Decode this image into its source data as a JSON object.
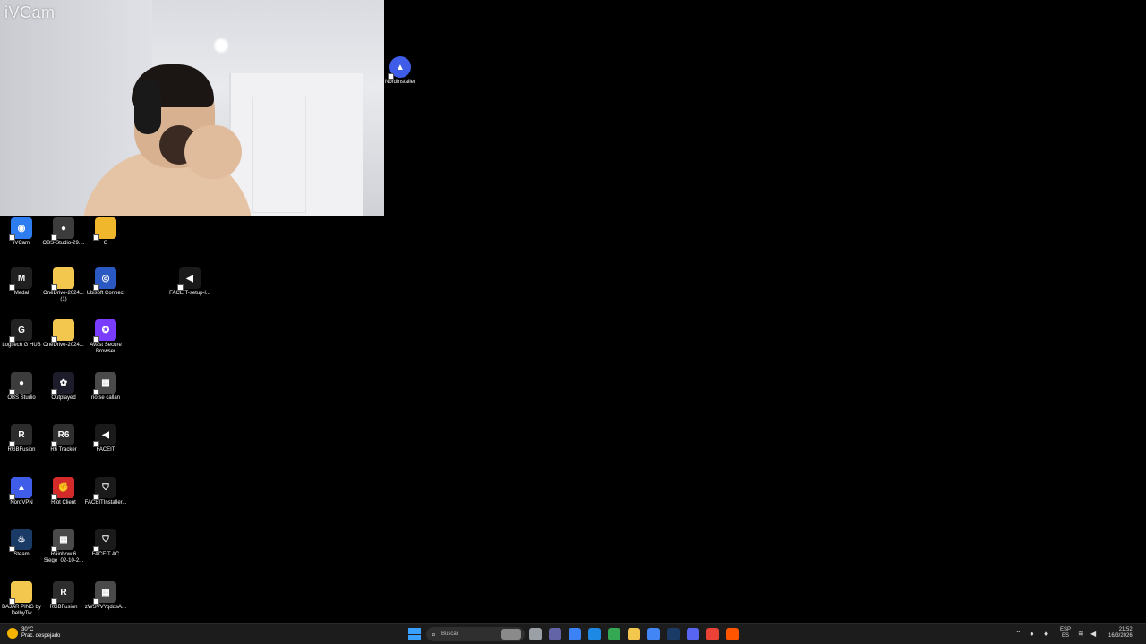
{
  "webcam": {
    "label": "iVCam"
  },
  "desktop": {
    "icons": [
      {
        "label": "iVCam",
        "color": "#2d7cf0",
        "glyph": "◉"
      },
      {
        "label": "OBS-Studio-29....",
        "color": "#3c3c3c",
        "glyph": "●"
      },
      {
        "label": "G",
        "color": "#f0b72c",
        "glyph": ""
      },
      {
        "label": "Medal",
        "color": "#202020",
        "glyph": "M"
      },
      {
        "label": "OneDrive-2024... (1)",
        "color": "#f3c74d",
        "glyph": ""
      },
      {
        "label": "Ubisoft Connect",
        "color": "#2b59c3",
        "glyph": "◎"
      },
      {
        "label": "FACEIT-setup-l...",
        "color": "#1a1a1a",
        "glyph": "◀"
      },
      {
        "label": "Logitech G HUB",
        "color": "#222222",
        "glyph": "G"
      },
      {
        "label": "OneDrive-2024...",
        "color": "#f3c74d",
        "glyph": ""
      },
      {
        "label": "Avast Secure Browser",
        "color": "#7a3cff",
        "glyph": "✪"
      },
      {
        "label": "OBS Studio",
        "color": "#3c3c3c",
        "glyph": "●"
      },
      {
        "label": "Outplayed",
        "color": "#1c1c2a",
        "glyph": "✿"
      },
      {
        "label": "no se callan",
        "color": "#4a4a4a",
        "glyph": "▦"
      },
      {
        "label": "RGBFusion",
        "color": "#2c2c2c",
        "glyph": "R"
      },
      {
        "label": "R6 Tracker",
        "color": "#2f2f2f",
        "glyph": "R6"
      },
      {
        "label": "FACEIT",
        "color": "#1a1a1a",
        "glyph": "◀"
      },
      {
        "label": "NordVPN",
        "color": "#3f5de8",
        "glyph": "▲"
      },
      {
        "label": "Riot Client",
        "color": "#d42a2a",
        "glyph": "✊"
      },
      {
        "label": "FACEITInstaller...",
        "color": "#1a1a1a",
        "glyph": "⛉"
      },
      {
        "label": "Steam",
        "color": "#1b3b67",
        "glyph": "♨"
      },
      {
        "label": "Rainbow 6 Siege_02-10-2...",
        "color": "#4a4a4a",
        "glyph": "▦"
      },
      {
        "label": "FACEIT AC",
        "color": "#1a1a1a",
        "glyph": "⛉"
      },
      {
        "label": "BAJAR PING by DelbyTw",
        "color": "#f3c74d",
        "glyph": ""
      },
      {
        "label": "RGBFusion",
        "color": "#2c2c2c",
        "glyph": "R"
      },
      {
        "label": "zWSVVYqddsA...",
        "color": "#4a4a4a",
        "glyph": "▦"
      },
      {
        "label": "NordInstaller",
        "color": "#3f5de8",
        "glyph": "▲"
      }
    ]
  },
  "taskbar": {
    "weather_temp": "30°C",
    "weather_desc": "Prac. despejado",
    "search_placeholder": "Buscar",
    "search_icon": "search-icon",
    "apps": [
      {
        "name": "task-view",
        "color": "#9aa0a6"
      },
      {
        "name": "teams",
        "color": "#6264a7"
      },
      {
        "name": "copilot",
        "color": "#3b82f6"
      },
      {
        "name": "edge",
        "color": "#1e88e5"
      },
      {
        "name": "chrome",
        "color": "#34a853"
      },
      {
        "name": "file-explorer",
        "color": "#f3c74d"
      },
      {
        "name": "microsoft-store",
        "color": "#4285f4"
      },
      {
        "name": "steam",
        "color": "#1b3b67"
      },
      {
        "name": "discord",
        "color": "#5865f2"
      },
      {
        "name": "chrome-2",
        "color": "#ea4335"
      },
      {
        "name": "faceit-ac",
        "color": "#ff5500"
      }
    ],
    "lang_top": "ESP",
    "lang_bottom": "ES",
    "time": "21:52",
    "date": "16/3/2026"
  }
}
